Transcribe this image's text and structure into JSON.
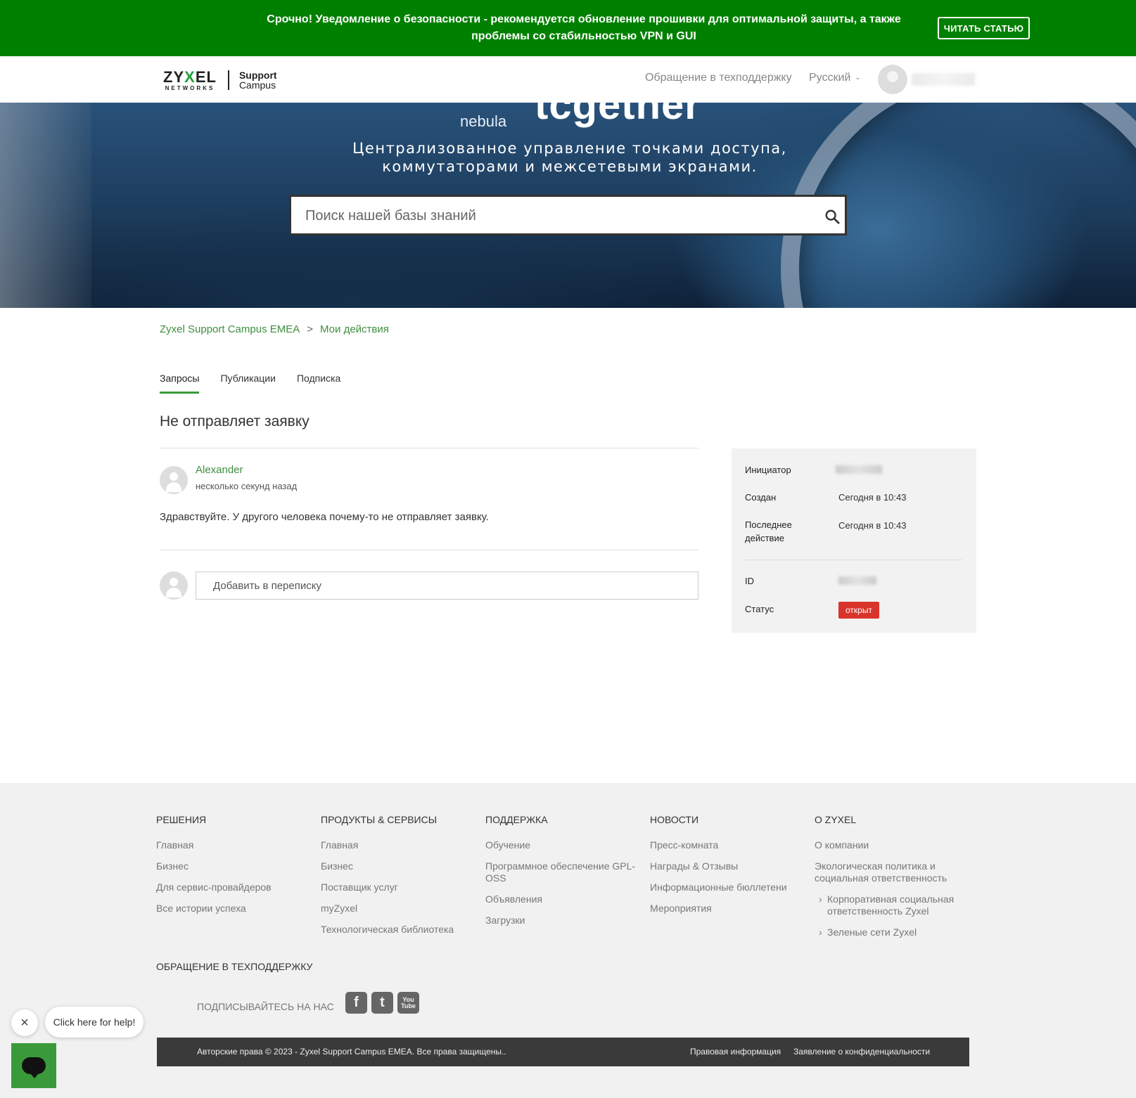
{
  "alert": {
    "text": "Срочно! Уведомление о безопасности - рекомендуется обновление прошивки для оптимальной защиты, а также проблемы со стабильностью VPN и GUI",
    "button": "ЧИТАТЬ СТАТЬЮ"
  },
  "header": {
    "logo": {
      "word_left": "ZY",
      "word_x": "X",
      "word_right": "EL",
      "networks": "NETWORKS",
      "campus_line1": "Support",
      "campus_line2": "Campus"
    },
    "support_link": "Обращение в техподдержку",
    "language": "Русский"
  },
  "hero": {
    "brand": "tcgether",
    "nebula": "nebula",
    "tagline": "Централизованное управление точками доступа, коммутаторами и межсетевыми экранами.",
    "search_placeholder": "Поиск нашей базы знаний"
  },
  "breadcrumb": {
    "home": "Zyxel Support Campus EMEA",
    "separator": ">",
    "current": "Мои действия"
  },
  "tabs": [
    "Запросы",
    "Публикации",
    "Подписка"
  ],
  "request": {
    "title": "Не отправляет заявку",
    "author": "Alexander",
    "time": "несколько секунд назад",
    "body": "Здравствуйте. У другого человека почему-то не отправляет заявку.",
    "reply_placeholder": "Добавить в переписку"
  },
  "sidebar": {
    "initiator_label": "Инициатор",
    "created_label": "Создан",
    "created_value": "Сегодня в 10:43",
    "last_action_label": "Последнее действие",
    "last_action_value": "Сегодня в 10:43",
    "id_label": "ID",
    "status_label": "Статус",
    "status_value": "открыт",
    "status_color": "#d9342b"
  },
  "footer": {
    "columns": [
      {
        "title": "РЕШЕНИЯ",
        "links": [
          "Главная",
          "Бизнес",
          "Для сервис-провайдеров",
          "Все истории успеха"
        ]
      },
      {
        "title": "ПРОДУКТЫ & СЕРВИСЫ",
        "links": [
          "Главная",
          "Бизнес",
          "Поставщик услуг",
          "myZyxel",
          "Технологическая библиотека"
        ]
      },
      {
        "title": "ПОДДЕРЖКА",
        "links": [
          "Обучение",
          "Программное обеспечение GPL-OSS",
          "Объявления",
          "Загрузки"
        ]
      },
      {
        "title": "НОВОСТИ",
        "links": [
          "Пресс-комната",
          "Награды & Отзывы",
          "Информационные бюллетени",
          "Мероприятия"
        ]
      },
      {
        "title": "О ZYXEL",
        "links": [
          "О компании",
          "Экологическая политика и социальная ответственность",
          "Корпоративная социальная ответственность Zyxel",
          "Зеленые сети Zyxel"
        ]
      }
    ],
    "support_heading": "ОБРАЩЕНИЕ В ТЕХПОДДЕРЖКУ",
    "follow_label": "ПОДПИСЫВАЙТЕСЬ НА НАС",
    "social": {
      "facebook": "f",
      "twitter": "t",
      "youtube": "You Tube"
    },
    "copyright": "Авторские права © 2023 - Zyxel Support Campus EMEA. Все права защищены..",
    "legal": "Правовая информация",
    "privacy": "Заявление о конфиденциальности"
  },
  "help_widget": {
    "bubble": "Click here for help!",
    "close": "×"
  },
  "colors": {
    "alert_green": "#008000",
    "accent_green": "#3a9a3a",
    "link_green": "#3f8f3f"
  }
}
